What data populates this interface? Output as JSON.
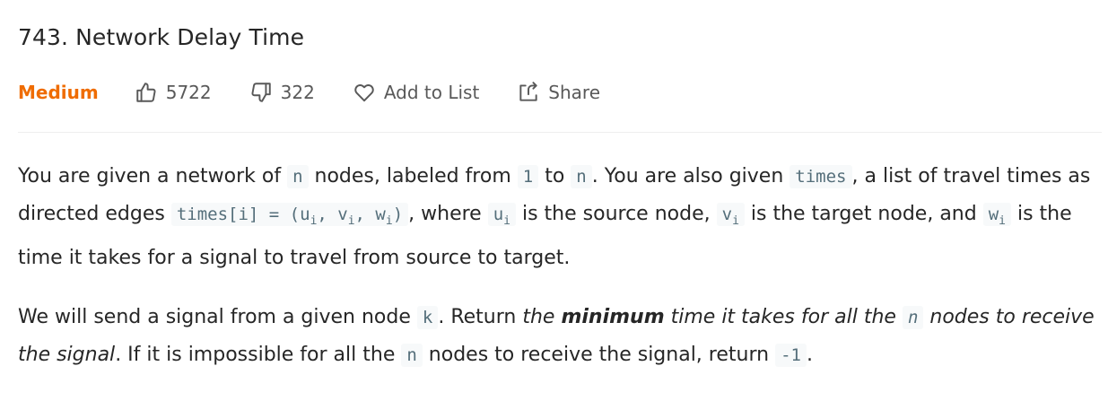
{
  "problem": {
    "title": "743. Network Delay Time",
    "difficulty": "Medium",
    "difficulty_color": "#ef6c00",
    "likes": "5722",
    "dislikes": "322",
    "add_to_list_label": "Add to List",
    "share_label": "Share"
  },
  "icons": {
    "like": "thumbs-up-icon",
    "dislike": "thumbs-down-icon",
    "add_to_list": "heart-icon",
    "share": "share-icon"
  },
  "description": {
    "p1": {
      "t1": "You are given a network of ",
      "c1": "n",
      "t2": " nodes, labeled from ",
      "c2": "1",
      "t3": " to ",
      "c3": "n",
      "t4": ". You are also given ",
      "c4": "times",
      "t5": ", a list of travel times as directed edges ",
      "c5a": "times[i] = (u",
      "c5s1": "i",
      "c5b": ", v",
      "c5s2": "i",
      "c5c": ", w",
      "c5s3": "i",
      "c5d": ")",
      "t6": ", where ",
      "c6a": "u",
      "c6s": "i",
      "t7": " is the source node, ",
      "c7a": "v",
      "c7s": "i",
      "t8": " is the target node, and ",
      "c8a": "w",
      "c8s": "i",
      "t9": " is the time it takes for a signal to travel from source to target."
    },
    "p2": {
      "t1": "We will send a signal from a given node ",
      "c1": "k",
      "t2": ". Return ",
      "e1": "the ",
      "s1": "minimum",
      "e2": " time it takes for all the ",
      "c2": "n",
      "e3": " nodes to receive the signal",
      "t3": ". If it is impossible for all the ",
      "c3": "n",
      "t4": " nodes to receive the signal, return ",
      "c4": "-1",
      "t5": "."
    }
  }
}
